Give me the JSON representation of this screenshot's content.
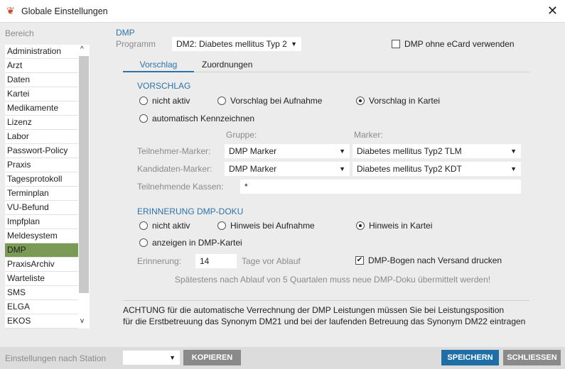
{
  "window": {
    "title": "Globale Einstellungen",
    "close": "✕"
  },
  "sidebar": {
    "label": "Bereich",
    "selected": "DMP",
    "items": [
      "Administration",
      "Arzt",
      "Daten",
      "Kartei",
      "Medikamente",
      "Lizenz",
      "Labor",
      "Passwort-Policy",
      "Praxis",
      "Tagesprotokoll",
      "Terminplan",
      "VU-Befund",
      "Impfplan",
      "Meldesystem",
      "DMP",
      "PraxisArchiv",
      "Warteliste",
      "SMS",
      "ELGA",
      "EKOS"
    ]
  },
  "main": {
    "section": "DMP",
    "program_label": "Programm",
    "program_value": "DM2: Diabetes mellitus Typ 2",
    "ecard_label": "DMP ohne eCard verwenden",
    "ecard_checked": false,
    "tabs": [
      "Vorschlag",
      "Zuordnungen"
    ],
    "active_tab": "Vorschlag",
    "vorschlag": {
      "heading": "VORSCHLAG",
      "options": [
        "nicht aktiv",
        "Vorschlag bei Aufnahme",
        "Vorschlag in Kartei",
        "automatisch Kennzeichnen"
      ],
      "selected": "Vorschlag in Kartei"
    },
    "gruppe_label": "Gruppe:",
    "marker_label": "Marker:",
    "teilnehmer": {
      "label": "Teilnehmer-Marker:",
      "gruppe": "DMP Marker",
      "marker": "Diabetes mellitus Typ2 TLM"
    },
    "kandidaten": {
      "label": "Kandidaten-Marker:",
      "gruppe": "DMP Marker",
      "marker": "Diabetes mellitus Typ2 KDT"
    },
    "kassen": {
      "label": "Teilnehmende Kassen:",
      "value": "*"
    },
    "erinnerung": {
      "heading": "ERINNERUNG DMP-DOKU",
      "options": [
        "nicht aktiv",
        "Hinweis bei Aufnahme",
        "Hinweis in Kartei",
        "anzeigen in DMP-Kartei"
      ],
      "selected": "Hinweis in Kartei",
      "label": "Erinnerung:",
      "value": "14",
      "unit": "Tage vor Ablauf",
      "print_label": "DMP-Bogen nach Versand drucken",
      "print_checked": true,
      "note": "Spätestens nach Ablauf von 5 Quartalen muss neue DMP-Doku übermittelt werden!"
    },
    "warning": [
      "ACHTUNG für die automatische Verrechnung der DMP Leistungen müssen Sie bei Leistungsposition",
      "für die Erstbetreuung das Synonym DM21 und bei der laufenden Betreuung das Synonym DM22 eintragen"
    ]
  },
  "footer": {
    "station_label": "Einstellungen nach Station",
    "station_value": "",
    "copy": "KOPIEREN",
    "save": "SPEICHERN",
    "close": "SCHLIESSEN"
  },
  "colors": {
    "accent": "#2e72a8",
    "selected": "#7a9a55",
    "save": "#1f6fa6",
    "gray_button": "#8a8a8a"
  }
}
